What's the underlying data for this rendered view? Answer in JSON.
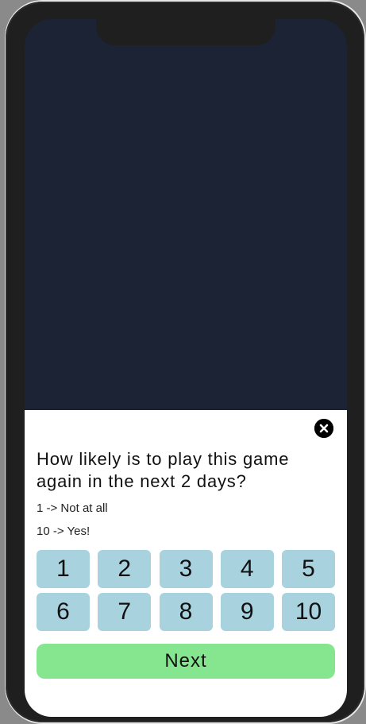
{
  "survey": {
    "question": "How likely is to play this game again in the next 2 days?",
    "hint_low": "1 -> Not at all",
    "hint_high": "10 -> Yes!",
    "options": [
      "1",
      "2",
      "3",
      "4",
      "5",
      "6",
      "7",
      "8",
      "9",
      "10"
    ],
    "next_label": "Next"
  },
  "icons": {
    "close": "close-icon"
  },
  "colors": {
    "background": "#1b2334",
    "sheet": "#ffffff",
    "option_button": "#a9d2df",
    "next_button": "#86e58f"
  }
}
